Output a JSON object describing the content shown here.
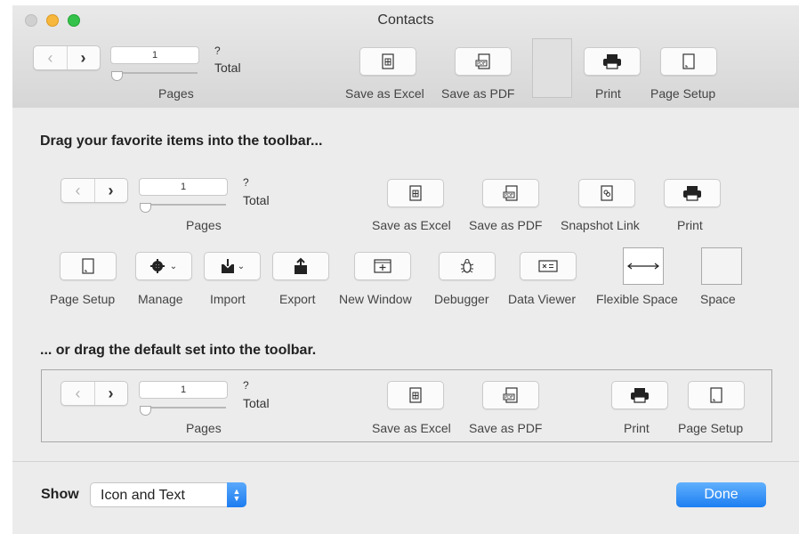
{
  "window": {
    "title": "Contacts"
  },
  "toolbar": {
    "page_value": "1",
    "page_question": "?",
    "total_label": "Total",
    "pages_label": "Pages",
    "items": {
      "save_excel": "Save as Excel",
      "save_pdf": "Save as PDF",
      "print": "Print",
      "page_setup": "Page Setup"
    }
  },
  "palette": {
    "heading": "Drag your favorite items into the toolbar...",
    "page_value": "1",
    "page_question": "?",
    "total_label": "Total",
    "pages_label": "Pages",
    "items": {
      "save_excel": "Save as Excel",
      "save_pdf": "Save as PDF",
      "snapshot_link": "Snapshot Link",
      "print": "Print",
      "page_setup": "Page Setup",
      "manage": "Manage",
      "import": "Import",
      "export": "Export",
      "new_window": "New Window",
      "debugger": "Debugger",
      "data_viewer": "Data Viewer",
      "flexible_space": "Flexible Space",
      "space": "Space"
    }
  },
  "default_set": {
    "heading": "... or drag the default set into the toolbar.",
    "page_value": "1",
    "page_question": "?",
    "total_label": "Total",
    "pages_label": "Pages",
    "items": {
      "save_excel": "Save as Excel",
      "save_pdf": "Save as PDF",
      "print": "Print",
      "page_setup": "Page Setup"
    }
  },
  "footer": {
    "show_label": "Show",
    "show_value": "Icon and Text",
    "done_label": "Done"
  },
  "colors": {
    "accent": "#1d7ff1",
    "close": "#d0d0d0",
    "minimize": "#f6b73c",
    "maximize": "#35c24a"
  }
}
